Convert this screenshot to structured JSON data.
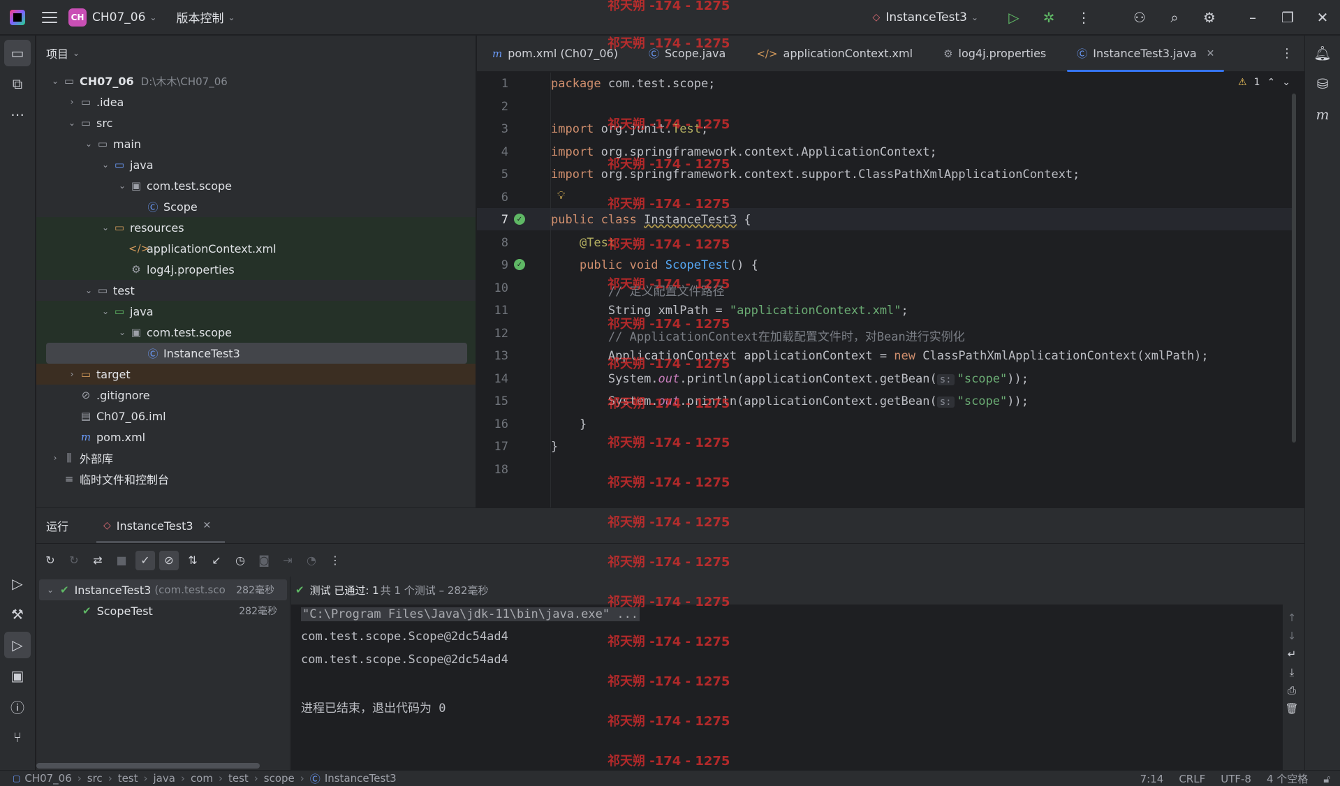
{
  "titlebar": {
    "project_badge": "CH",
    "project_name": "CH07_06",
    "vcs_menu": "版本控制",
    "run_config": "InstanceTest3"
  },
  "project_panel": {
    "title": "项目",
    "root_name": "CH07_06",
    "root_path": "D:\\木木\\CH07_06",
    "items": [
      {
        "label": ".idea"
      },
      {
        "label": "src"
      },
      {
        "label": "main"
      },
      {
        "label": "java"
      },
      {
        "label": "com.test.scope"
      },
      {
        "label": "Scope"
      },
      {
        "label": "resources"
      },
      {
        "label": "applicationContext.xml"
      },
      {
        "label": "log4j.properties"
      },
      {
        "label": "test"
      },
      {
        "label": "java"
      },
      {
        "label": "com.test.scope"
      },
      {
        "label": "InstanceTest3"
      },
      {
        "label": "target"
      },
      {
        "label": ".gitignore"
      },
      {
        "label": "Ch07_06.iml"
      },
      {
        "label": "pom.xml"
      },
      {
        "label": "外部库"
      },
      {
        "label": "临时文件和控制台"
      }
    ]
  },
  "editor_tabs": [
    {
      "label": "pom.xml (Ch07_06)"
    },
    {
      "label": "Scope.java"
    },
    {
      "label": "applicationContext.xml"
    },
    {
      "label": "log4j.properties"
    },
    {
      "label": "InstanceTest3.java"
    }
  ],
  "editor": {
    "warning_count": "1",
    "line_numbers": [
      "1",
      "2",
      "3",
      "4",
      "5",
      "6",
      "7",
      "8",
      "9",
      "10",
      "11",
      "12",
      "13",
      "14",
      "15",
      "16",
      "17",
      "18"
    ],
    "code": {
      "l1_kw": "package",
      "l1_rest": " com.test.scope;",
      "l3_kw": "import",
      "l3_rest": " org.junit.",
      "l3_cls": "Test",
      "l3_end": ";",
      "l4_kw": "import",
      "l4_rest": " org.springframework.context.ApplicationContext;",
      "l5_kw": "import",
      "l5_rest": " org.springframework.context.support.ClassPathXmlApplicationContext;",
      "l7_kw": "public class",
      "l7_cls": "InstanceTest3",
      "l7_end": " {",
      "l8_ann": "@Test",
      "l9_kw": "public void",
      "l9_fn": "ScopeTest",
      "l9_end": "() {",
      "l10_cmt": "// 定义配置文件路径",
      "l11_a": "String xmlPath = ",
      "l11_str": "\"applicationContext.xml\"",
      "l11_end": ";",
      "l12_cmt": "// ApplicationContext在加载配置文件时，对Bean进行实例化",
      "l13_a": "ApplicationContext applicationContext = ",
      "l13_kw": "new",
      "l13_b": " ClassPathXmlApplicationContext(xmlPath);",
      "l14_a": "System.",
      "l14_out": "out",
      "l14_b": ".println(applicationContext.getBean(",
      "l14_hint": "s:",
      "l14_str": "\"scope\"",
      "l14_end": "));",
      "l15_a": "System.",
      "l15_out": "out",
      "l15_b": ".println(applicationContext.getBean(",
      "l15_hint": "s:",
      "l15_str": "\"scope\"",
      "l15_end": "));",
      "l16": "}",
      "l17": "}"
    }
  },
  "run_panel": {
    "title": "运行",
    "tab_label": "InstanceTest3",
    "status_prefix": "测试 已通过: 1",
    "status_suffix": "共 1 个测试 – 282毫秒",
    "test_tree": [
      {
        "name": "InstanceTest3",
        "hint": "(com.test.sco",
        "time": "282毫秒"
      },
      {
        "name": "ScopeTest",
        "time": "282毫秒"
      }
    ],
    "console_lines": [
      "\"C:\\Program Files\\Java\\jdk-11\\bin\\java.exe\" ...",
      "com.test.scope.Scope@2dc54ad4",
      "com.test.scope.Scope@2dc54ad4",
      "进程已结束，退出代码为 0"
    ]
  },
  "statusbar": {
    "breadcrumbs": [
      "CH07_06",
      "src",
      "test",
      "java",
      "com",
      "test",
      "scope",
      "InstanceTest3"
    ],
    "position": "7:14",
    "line_sep": "CRLF",
    "encoding": "UTF-8",
    "indent": "4 个空格"
  },
  "watermark": "祁天朔 -174 - 1275",
  "colors": {
    "accent": "#3574f0",
    "success": "#5fb865",
    "keyword": "#cf8e6d",
    "string": "#6aab73",
    "watermark": "#dc2d2d"
  }
}
